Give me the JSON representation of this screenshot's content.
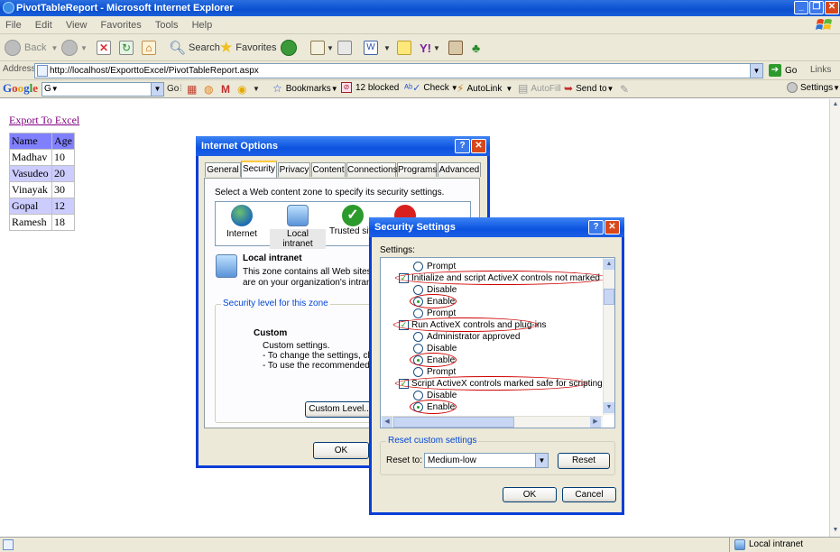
{
  "window": {
    "title": "PivotTableReport - Microsoft Internet Explorer",
    "minimize": "_",
    "maximize": "❐",
    "close": "✕"
  },
  "menu": [
    "File",
    "Edit",
    "View",
    "Favorites",
    "Tools",
    "Help"
  ],
  "toolbar": {
    "back": "Back",
    "search": "Search",
    "favorites": "Favorites"
  },
  "address": {
    "label": "Address",
    "url": "http://localhost/ExporttoExcel/PivotTableReport.aspx",
    "go": "Go",
    "links": "Links"
  },
  "googlebar": {
    "logo": "Google",
    "search_value": "G",
    "go": "Go",
    "bookmarks": "Bookmarks",
    "blocked": "12 blocked",
    "check": "Check",
    "autolink": "AutoLink",
    "autofill": "AutoFill",
    "sendto": "Send to",
    "settings": "Settings"
  },
  "page": {
    "export_link": "Export To Excel",
    "table": {
      "headers": [
        "Name",
        "Age"
      ],
      "rows": [
        [
          "Madhav",
          "10"
        ],
        [
          "Vasudeo",
          "20"
        ],
        [
          "Vinayak",
          "30"
        ],
        [
          "Gopal",
          "12"
        ],
        [
          "Ramesh",
          "18"
        ]
      ]
    }
  },
  "internet_options": {
    "title": "Internet Options",
    "help": "?",
    "close": "✕",
    "tabs": [
      "General",
      "Security",
      "Privacy",
      "Content",
      "Connections",
      "Programs",
      "Advanced"
    ],
    "instruction": "Select a Web content zone to specify its security settings.",
    "zones": [
      "Internet",
      "Local intranet",
      "Trusted sites"
    ],
    "zone_title": "Local intranet",
    "zone_desc_1": "This zone contains all Web sites that",
    "zone_desc_2": "are on your organization's intranet.",
    "level_group": "Security level for this zone",
    "level_name": "Custom",
    "level_desc_1": "Custom settings.",
    "level_desc_2": "- To change the settings, click C",
    "level_desc_3": "- To use the recommended setti",
    "custom_level": "Custom Level...",
    "ok": "OK"
  },
  "security_settings": {
    "title": "Security Settings",
    "help": "?",
    "close": "✕",
    "settings_label": "Settings:",
    "list": [
      {
        "type": "radio",
        "label": "Prompt",
        "checked": false
      },
      {
        "type": "check",
        "label": "Initialize and script ActiveX controls not marked as safe"
      },
      {
        "type": "radio",
        "label": "Disable",
        "checked": false
      },
      {
        "type": "radio",
        "label": "Enable",
        "checked": true
      },
      {
        "type": "radio",
        "label": "Prompt",
        "checked": false
      },
      {
        "type": "check",
        "label": "Run ActiveX controls and plug-ins"
      },
      {
        "type": "radio",
        "label": "Administrator approved",
        "checked": false
      },
      {
        "type": "radio",
        "label": "Disable",
        "checked": false
      },
      {
        "type": "radio",
        "label": "Enable",
        "checked": true
      },
      {
        "type": "radio",
        "label": "Prompt",
        "checked": false
      },
      {
        "type": "check",
        "label": "Script ActiveX controls marked safe for scripting"
      },
      {
        "type": "radio",
        "label": "Disable",
        "checked": false
      },
      {
        "type": "radio",
        "label": "Enable",
        "checked": true
      }
    ],
    "reset_group": "Reset custom settings",
    "reset_to_label": "Reset to:",
    "reset_to_value": "Medium-low",
    "reset": "Reset",
    "ok": "OK",
    "cancel": "Cancel"
  },
  "status": {
    "zone": "Local intranet"
  },
  "colors": {
    "titlebar": "#0a4fd0",
    "highlight": "#d00000",
    "table_header": "#8080ff",
    "table_alt": "#ccccff"
  }
}
